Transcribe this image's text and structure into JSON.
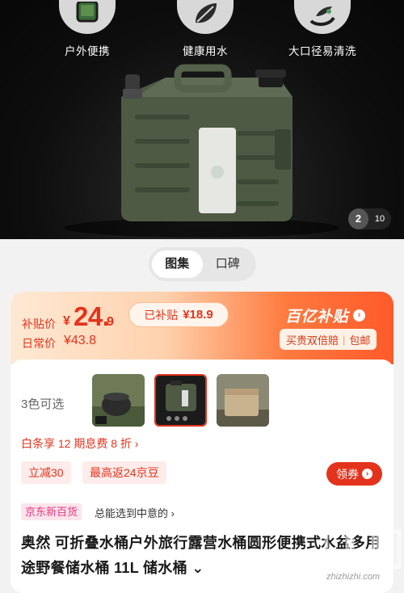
{
  "hero": {
    "features": [
      {
        "label": "户外便携",
        "icon": "backpack-icon"
      },
      {
        "label": "健康用水",
        "icon": "leaf-icon"
      },
      {
        "label": "大口径易清洗",
        "icon": "water-drop-icon"
      }
    ],
    "image_counter": {
      "current": "2",
      "total": "10"
    }
  },
  "tabs": [
    {
      "label": "图集",
      "active": true
    },
    {
      "label": "口碑",
      "active": false
    }
  ],
  "price": {
    "subsidy_label": "补贴价",
    "currency": "¥",
    "integer": "24.",
    "decimal": "9",
    "daily_label": "日常价",
    "daily_value": "¥43.8",
    "subsidized_label": "已补贴",
    "subsidized_value": "¥18.9",
    "brand": "百亿补贴",
    "guarantee_left": "买贵双倍赔",
    "guarantee_sep": "|",
    "guarantee_right": "包邮",
    "accent": "#e4331c"
  },
  "options": {
    "color_label": "3色可选",
    "thumbnail_count": 3,
    "selected_index": 1
  },
  "promo": {
    "installment": "白条享 12 期息费 8 折 ›",
    "coupons": [
      "立减30",
      "最高返24京豆"
    ],
    "claim_label": "领券",
    "new_badge": "京东新百货",
    "new_tagline": "总能选到中意的 ›"
  },
  "product": {
    "title": "奥然 可折叠水桶户外旅行露营水桶圆形便携式水盆多用途野餐储水桶 11L 储水桶 ⌄"
  },
  "watermark": {
    "text": "zhizhizhi.com"
  }
}
